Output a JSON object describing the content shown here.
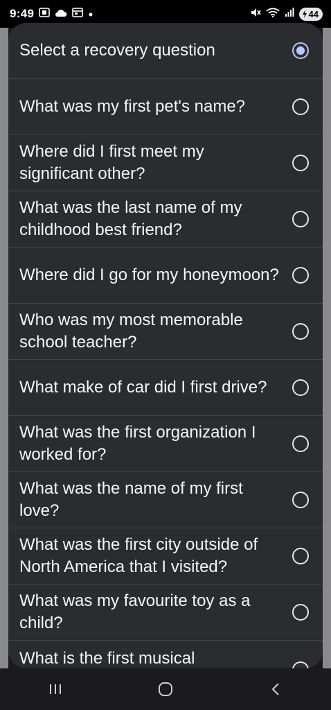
{
  "status_bar": {
    "time": "9:49",
    "battery": "44",
    "icons": [
      "screenshot-icon",
      "cloud-icon",
      "calendar-icon",
      "dot-icon",
      "mute-icon",
      "wifi-icon",
      "signal-icon",
      "battery-icon"
    ]
  },
  "dialog": {
    "title": "Select a recovery question",
    "title_selected": true,
    "options": [
      "What was my first pet's name?",
      "Where did I first meet my significant other?",
      "What was the last name of my childhood best friend?",
      "Where did I go for my honeymoon?",
      "Who was my most memorable school teacher?",
      "What make of car did I first drive?",
      "What was the first organization I worked for?",
      "What was the name of my first love?",
      "What was the first city outside of North America that I visited?",
      "What was my favourite toy as a child?",
      "What is the first musical"
    ]
  },
  "colors": {
    "dialog_bg": "#2b2c30",
    "selected_radio": "#b9c8ff",
    "background": "#1b1b1d"
  },
  "nav_bar": {
    "icons": [
      "recents-icon",
      "home-icon",
      "back-icon"
    ]
  }
}
